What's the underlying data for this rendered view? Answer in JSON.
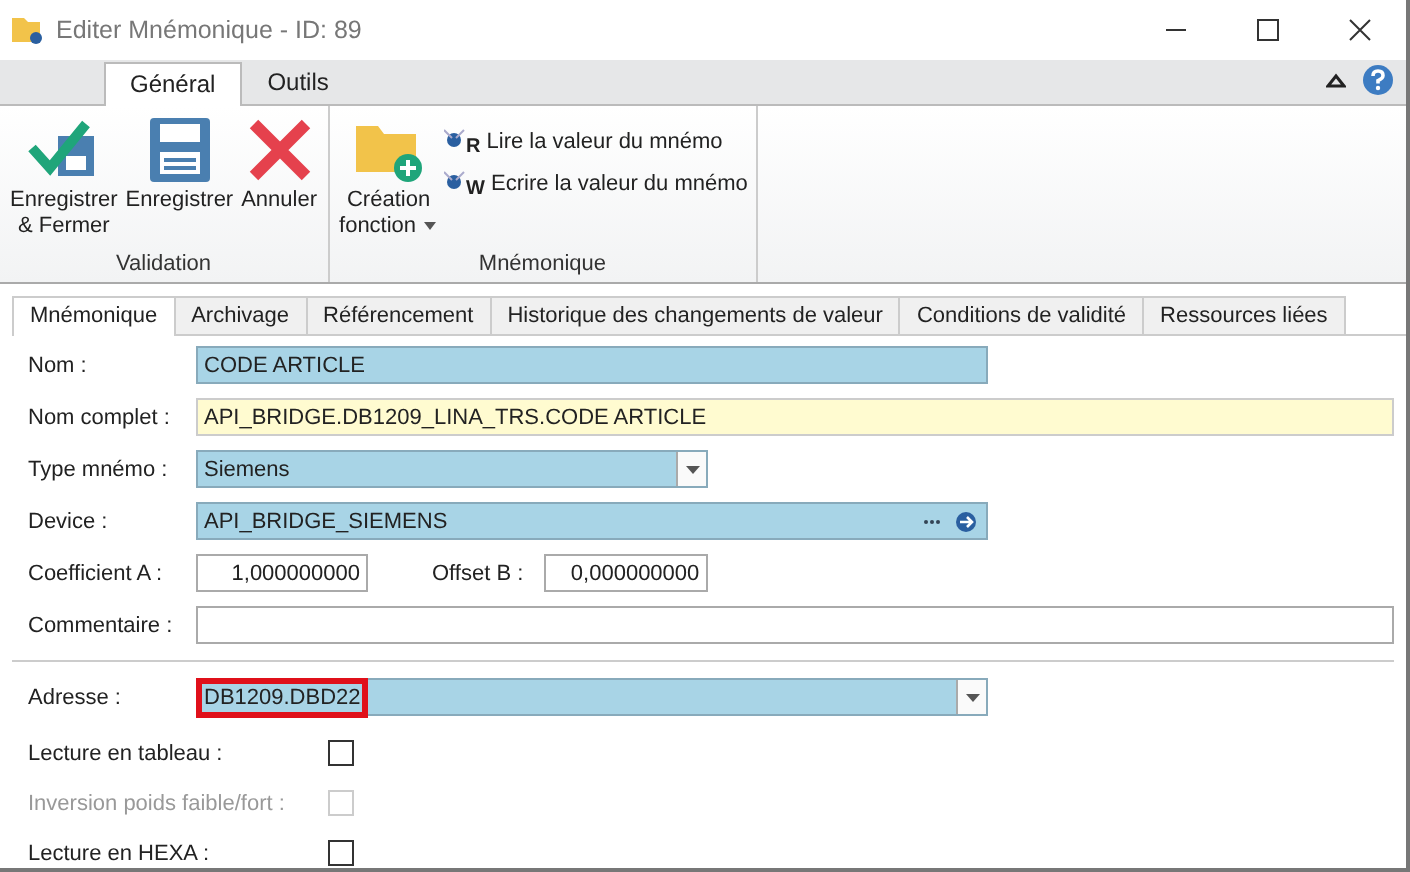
{
  "window": {
    "title": "Editer Mnémonique - ID: 89"
  },
  "ribbon_tabs": [
    {
      "label": "Général",
      "selected": true
    },
    {
      "label": "Outils",
      "selected": false
    }
  ],
  "ribbon_groups": [
    {
      "label": "Validation",
      "buttons": [
        {
          "kind": "save-close",
          "label": "Enregistrer\n& Fermer"
        },
        {
          "kind": "save",
          "label": "Enregistrer"
        },
        {
          "kind": "cancel",
          "label": "Annuler"
        }
      ]
    },
    {
      "label": "Mnémonique",
      "buttons": [
        {
          "kind": "folder",
          "label": "Création\nfonction",
          "dropdown": true
        }
      ],
      "small_buttons": [
        {
          "letter": "R",
          "label": "Lire la valeur du mnémo"
        },
        {
          "letter": "W",
          "label": "Ecrire la valeur du mnémo"
        }
      ]
    }
  ],
  "tabs": [
    {
      "label": "Mnémonique",
      "selected": true
    },
    {
      "label": "Archivage",
      "selected": false
    },
    {
      "label": "Référencement",
      "selected": false
    },
    {
      "label": "Historique des changements de valeur",
      "selected": false
    },
    {
      "label": "Conditions de validité",
      "selected": false
    },
    {
      "label": "Ressources liées",
      "selected": false
    }
  ],
  "fields": {
    "nom": {
      "label": "Nom :",
      "value": "CODE ARTICLE"
    },
    "nom_complet": {
      "label": "Nom complet :",
      "value": "API_BRIDGE.DB1209_LINA_TRS.CODE ARTICLE"
    },
    "type": {
      "label": "Type mnémo :",
      "value": "Siemens"
    },
    "device": {
      "label": "Device :",
      "value": "API_BRIDGE_SIEMENS"
    },
    "coef": {
      "label": "Coefficient A :",
      "value": "1,000000000"
    },
    "offset": {
      "label": "Offset B :",
      "value": "0,000000000"
    },
    "commentaire": {
      "label": "Commentaire :"
    }
  },
  "address": {
    "label": "Adresse :",
    "value": "DB1209.DBD22",
    "highlighted": true
  },
  "options": [
    {
      "label": "Lecture en tableau :",
      "checked": false,
      "disabled": false
    },
    {
      "label": "Inversion poids faible/fort :",
      "checked": false,
      "disabled": true
    },
    {
      "label": "Lecture en HEXA :",
      "checked": false,
      "disabled": false
    }
  ]
}
